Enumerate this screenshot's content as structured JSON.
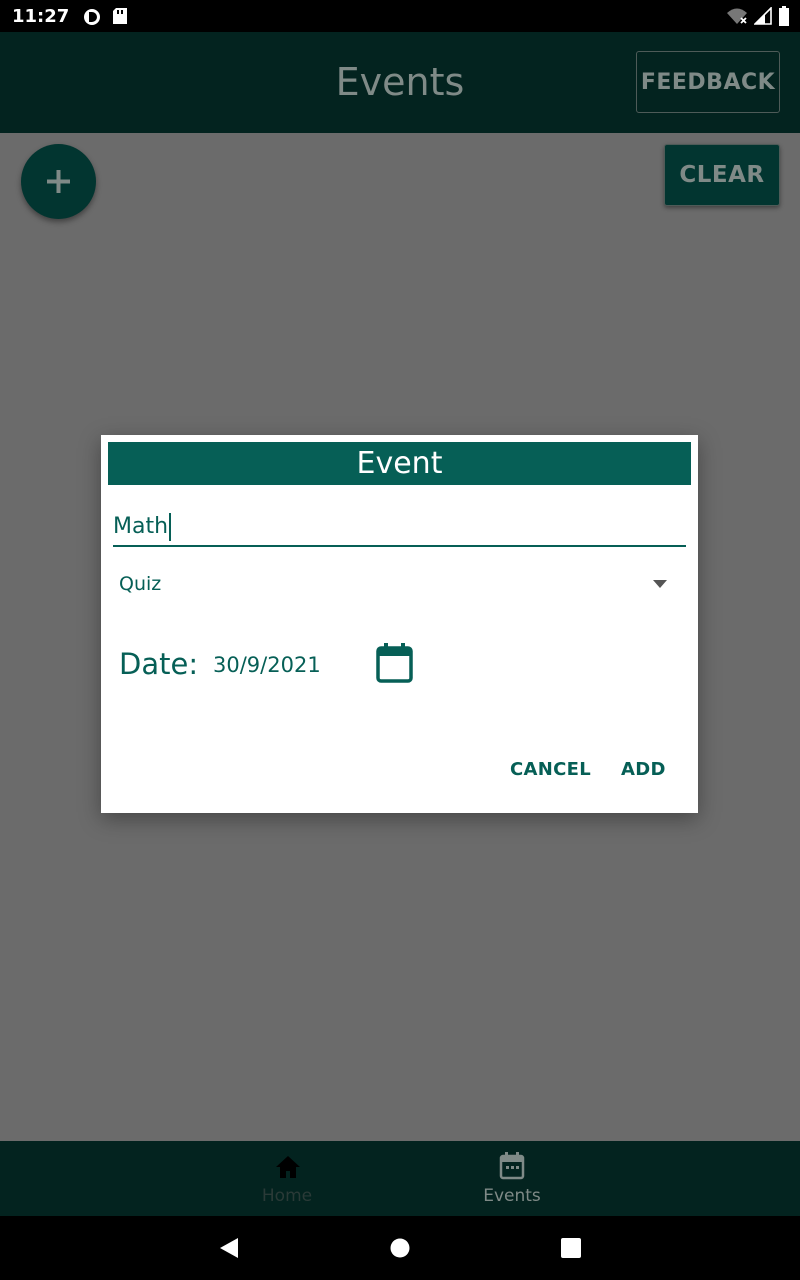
{
  "status_bar": {
    "time": "11:27"
  },
  "app_bar": {
    "title": "Events",
    "feedback_label": "FEEDBACK"
  },
  "toolbar": {
    "clear_label": "CLEAR",
    "add_icon": "plus-icon"
  },
  "dialog": {
    "title": "Event",
    "name_value": "Math",
    "type_selected": "Quiz",
    "date_label": "Date:",
    "date_value": "30/9/2021",
    "cancel_label": "CANCEL",
    "add_label": "ADD"
  },
  "bottom_nav": {
    "items": [
      {
        "label": "Home",
        "icon": "home-icon"
      },
      {
        "label": "Events",
        "icon": "calendar-icon"
      }
    ]
  },
  "colors": {
    "primary": "#065f56",
    "primary_dark": "#03231f",
    "scrim": "#6b6b6b"
  }
}
